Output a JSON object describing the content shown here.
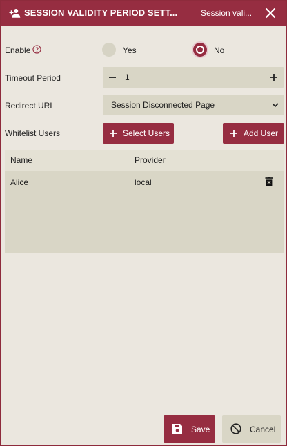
{
  "dialog": {
    "title": "SESSION VALIDITY PERIOD SETT...",
    "subtitle": "Session vali...",
    "icons": {
      "title": "person-add-icon",
      "close": "close-icon"
    }
  },
  "form": {
    "enable": {
      "label": "Enable",
      "help_icon": "help-circle-icon",
      "options": [
        {
          "label": "Yes",
          "selected": false
        },
        {
          "label": "No",
          "selected": true
        }
      ]
    },
    "timeout": {
      "label": "Timeout Period",
      "value": "1"
    },
    "redirect": {
      "label": "Redirect URL",
      "selected": "Session Disconnected Page"
    },
    "whitelist": {
      "label": "Whitelist Users",
      "select_users_label": "Select Users",
      "add_user_label": "Add User"
    }
  },
  "table": {
    "columns": [
      "Name",
      "Provider"
    ],
    "rows": [
      {
        "name": "Alice",
        "provider": "local"
      }
    ]
  },
  "footer": {
    "save_label": "Save",
    "cancel_label": "Cancel"
  },
  "colors": {
    "accent": "#962d41",
    "background": "#ebe7df",
    "field": "#d9d6c6"
  }
}
